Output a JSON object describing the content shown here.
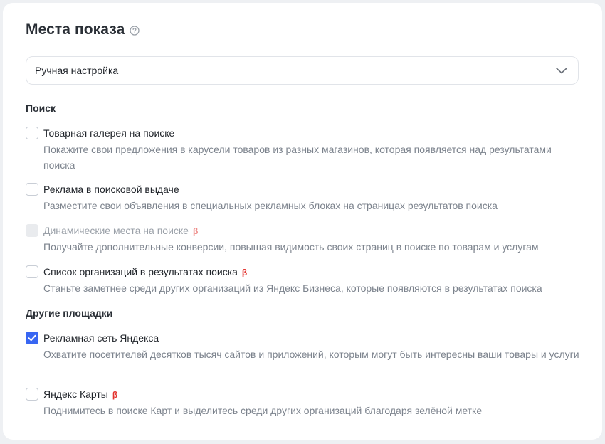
{
  "header": {
    "title": "Места показа",
    "help_icon": "question-circle-icon"
  },
  "select": {
    "value": "Ручная настройка",
    "icon": "chevron-down-icon"
  },
  "sections": [
    {
      "title": "Поиск",
      "options": [
        {
          "label": "Товарная галерея на поиске",
          "description": "Покажите свои предложения в карусели товаров из разных магазинов, которая появляется над результатами поиска",
          "checked": false,
          "disabled": false,
          "beta": ""
        },
        {
          "label": "Реклама в поисковой выдаче",
          "description": "Разместите свои объявления в специальных рекламных блоках на страницах результатов поиска",
          "checked": false,
          "disabled": false,
          "beta": ""
        },
        {
          "label": "Динамические места на поиске",
          "description": "Получайте дополнительные конверсии, повышая видимость своих страниц в поиске по товарам и услугам",
          "checked": false,
          "disabled": true,
          "beta": "β"
        },
        {
          "label": "Список организаций в результатах поиска",
          "description": "Станьте заметнее среди других организаций из Яндекс Бизнеса, которые появляются в результатах поиска",
          "checked": false,
          "disabled": false,
          "beta": "β"
        }
      ]
    },
    {
      "title": "Другие площадки",
      "options": [
        {
          "label": "Рекламная сеть Яндекса",
          "description": "Охватите посетителей десятков тысяч сайтов и приложений, которым могут быть интересны ваши товары и услуги",
          "checked": true,
          "disabled": false,
          "beta": ""
        },
        {
          "label": "Яндекс Карты",
          "description": "Поднимитесь в поиске Карт и выделитесь среди других организаций благодаря зелёной метке",
          "checked": false,
          "disabled": false,
          "beta": "β"
        }
      ]
    }
  ],
  "colors": {
    "accent": "#3866f2",
    "beta": "#e3342f",
    "muted_text": "#7c838d"
  }
}
